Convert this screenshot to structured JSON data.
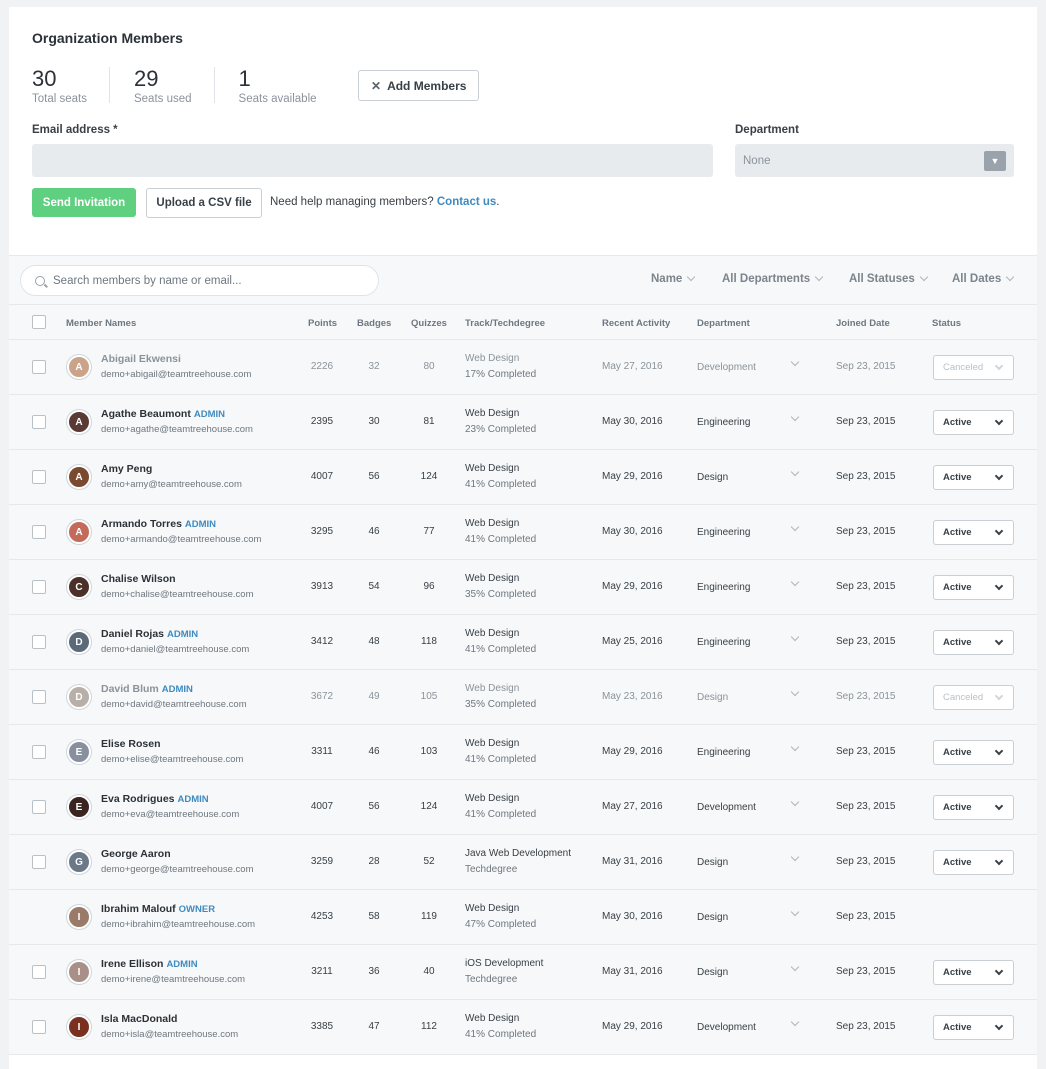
{
  "header": {
    "title": "Organization Members"
  },
  "stats": [
    {
      "value": "30",
      "label": "Total seats"
    },
    {
      "value": "29",
      "label": "Seats used"
    },
    {
      "value": "1",
      "label": "Seats available"
    }
  ],
  "actions": {
    "add_members": "Add Members",
    "send_invitation": "Send Invitation",
    "upload_csv": "Upload a CSV file",
    "help_text": "Need help managing members?",
    "contact_link": "Contact us",
    "help_period": "."
  },
  "form": {
    "email_label": "Email address *",
    "email_value": "",
    "department_label": "Department",
    "department_value": "None"
  },
  "filters": {
    "search_placeholder": "Search members by name or email...",
    "sort": "Name",
    "departments": "All Departments",
    "statuses": "All Statuses",
    "dates": "All Dates"
  },
  "columns": {
    "names": "Member Names",
    "points": "Points",
    "badges": "Badges",
    "quizzes": "Quizzes",
    "track": "Track/Techdegree",
    "activity": "Recent Activity",
    "department": "Department",
    "joined": "Joined Date",
    "status": "Status"
  },
  "members": [
    {
      "name": "Abigail Ekwensi",
      "role": "",
      "email": "demo+abigail@teamtreehouse.com",
      "points": "2226",
      "badges": "32",
      "quizzes": "80",
      "track": "Web Design",
      "progress": "17% Completed",
      "activity": "May 27, 2016",
      "department": "Development",
      "joined": "Sep 23, 2015",
      "status": "Canceled",
      "canceled": true,
      "checkbox": true,
      "color": "#c9a48a"
    },
    {
      "name": "Agathe Beaumont",
      "role": "ADMIN",
      "email": "demo+agathe@teamtreehouse.com",
      "points": "2395",
      "badges": "30",
      "quizzes": "81",
      "track": "Web Design",
      "progress": "23% Completed",
      "activity": "May 30, 2016",
      "department": "Engineering",
      "joined": "Sep 23, 2015",
      "status": "Active",
      "canceled": false,
      "checkbox": true,
      "color": "#5a3a35"
    },
    {
      "name": "Amy Peng",
      "role": "",
      "email": "demo+amy@teamtreehouse.com",
      "points": "4007",
      "badges": "56",
      "quizzes": "124",
      "track": "Web Design",
      "progress": "41% Completed",
      "activity": "May 29, 2016",
      "department": "Design",
      "joined": "Sep 23, 2015",
      "status": "Active",
      "canceled": false,
      "checkbox": true,
      "color": "#7a4a30"
    },
    {
      "name": "Armando Torres",
      "role": "ADMIN",
      "email": "demo+armando@teamtreehouse.com",
      "points": "3295",
      "badges": "46",
      "quizzes": "77",
      "track": "Web Design",
      "progress": "41% Completed",
      "activity": "May 30, 2016",
      "department": "Engineering",
      "joined": "Sep 23, 2015",
      "status": "Active",
      "canceled": false,
      "checkbox": true,
      "color": "#c46a5a"
    },
    {
      "name": "Chalise Wilson",
      "role": "",
      "email": "demo+chalise@teamtreehouse.com",
      "points": "3913",
      "badges": "54",
      "quizzes": "96",
      "track": "Web Design",
      "progress": "35% Completed",
      "activity": "May 29, 2016",
      "department": "Engineering",
      "joined": "Sep 23, 2015",
      "status": "Active",
      "canceled": false,
      "checkbox": true,
      "color": "#4a3028"
    },
    {
      "name": "Daniel Rojas",
      "role": "ADMIN",
      "email": "demo+daniel@teamtreehouse.com",
      "points": "3412",
      "badges": "48",
      "quizzes": "118",
      "track": "Web Design",
      "progress": "41% Completed",
      "activity": "May 25, 2016",
      "department": "Engineering",
      "joined": "Sep 23, 2015",
      "status": "Active",
      "canceled": false,
      "checkbox": true,
      "color": "#5a6a78"
    },
    {
      "name": "David Blum",
      "role": "ADMIN",
      "email": "demo+david@teamtreehouse.com",
      "points": "3672",
      "badges": "49",
      "quizzes": "105",
      "track": "Web Design",
      "progress": "35% Completed",
      "activity": "May 23, 2016",
      "department": "Design",
      "joined": "Sep 23, 2015",
      "status": "Canceled",
      "canceled": true,
      "checkbox": true,
      "color": "#b8b0a8"
    },
    {
      "name": "Elise Rosen",
      "role": "",
      "email": "demo+elise@teamtreehouse.com",
      "points": "3311",
      "badges": "46",
      "quizzes": "103",
      "track": "Web Design",
      "progress": "41% Completed",
      "activity": "May 29, 2016",
      "department": "Engineering",
      "joined": "Sep 23, 2015",
      "status": "Active",
      "canceled": false,
      "checkbox": true,
      "color": "#8890a0"
    },
    {
      "name": "Eva Rodrigues",
      "role": "ADMIN",
      "email": "demo+eva@teamtreehouse.com",
      "points": "4007",
      "badges": "56",
      "quizzes": "124",
      "track": "Web Design",
      "progress": "41% Completed",
      "activity": "May 27, 2016",
      "department": "Development",
      "joined": "Sep 23, 2015",
      "status": "Active",
      "canceled": false,
      "checkbox": true,
      "color": "#3a2420"
    },
    {
      "name": "George Aaron",
      "role": "",
      "email": "demo+george@teamtreehouse.com",
      "points": "3259",
      "badges": "28",
      "quizzes": "52",
      "track": "Java Web Development",
      "progress": "Techdegree",
      "activity": "May 31, 2016",
      "department": "Design",
      "joined": "Sep 23, 2015",
      "status": "Active",
      "canceled": false,
      "checkbox": true,
      "color": "#6a7888"
    },
    {
      "name": "Ibrahim Malouf",
      "role": "OWNER",
      "email": "demo+ibrahim@teamtreehouse.com",
      "points": "4253",
      "badges": "58",
      "quizzes": "119",
      "track": "Web Design",
      "progress": "47% Completed",
      "activity": "May 30, 2016",
      "department": "Design",
      "joined": "Sep 23, 2015",
      "status": "",
      "canceled": false,
      "checkbox": false,
      "color": "#9a7a68"
    },
    {
      "name": "Irene Ellison",
      "role": "ADMIN",
      "email": "demo+irene@teamtreehouse.com",
      "points": "3211",
      "badges": "36",
      "quizzes": "40",
      "track": "iOS Development",
      "progress": "Techdegree",
      "activity": "May 31, 2016",
      "department": "Design",
      "joined": "Sep 23, 2015",
      "status": "Active",
      "canceled": false,
      "checkbox": true,
      "color": "#a89088"
    },
    {
      "name": "Isla MacDonald",
      "role": "",
      "email": "demo+isla@teamtreehouse.com",
      "points": "3385",
      "badges": "47",
      "quizzes": "112",
      "track": "Web Design",
      "progress": "41% Completed",
      "activity": "May 29, 2016",
      "department": "Development",
      "joined": "Sep 23, 2015",
      "status": "Active",
      "canceled": false,
      "checkbox": true,
      "color": "#7a3020"
    }
  ]
}
